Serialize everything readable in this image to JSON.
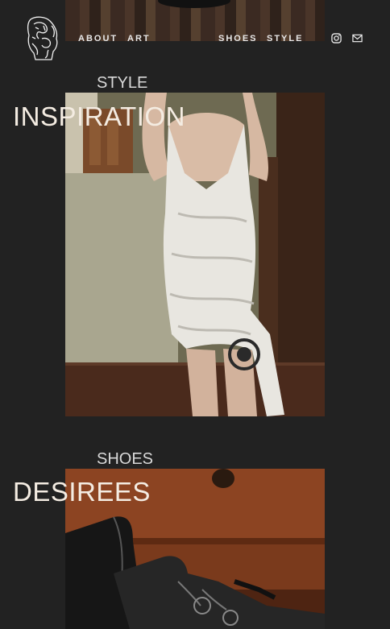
{
  "nav": {
    "left": [
      "ABOUT",
      "ART"
    ],
    "right": [
      "SHOES",
      "STYLE"
    ]
  },
  "header_icons": [
    "instagram-icon",
    "mail-icon"
  ],
  "posts": [
    {
      "category": "STYLE",
      "title": "INSPIRATION"
    },
    {
      "category": "SHOES",
      "title": "DESIREES"
    }
  ],
  "colors": {
    "background": "#222222",
    "title": "#f4ece2",
    "nav_text": "#e8e8e8"
  }
}
